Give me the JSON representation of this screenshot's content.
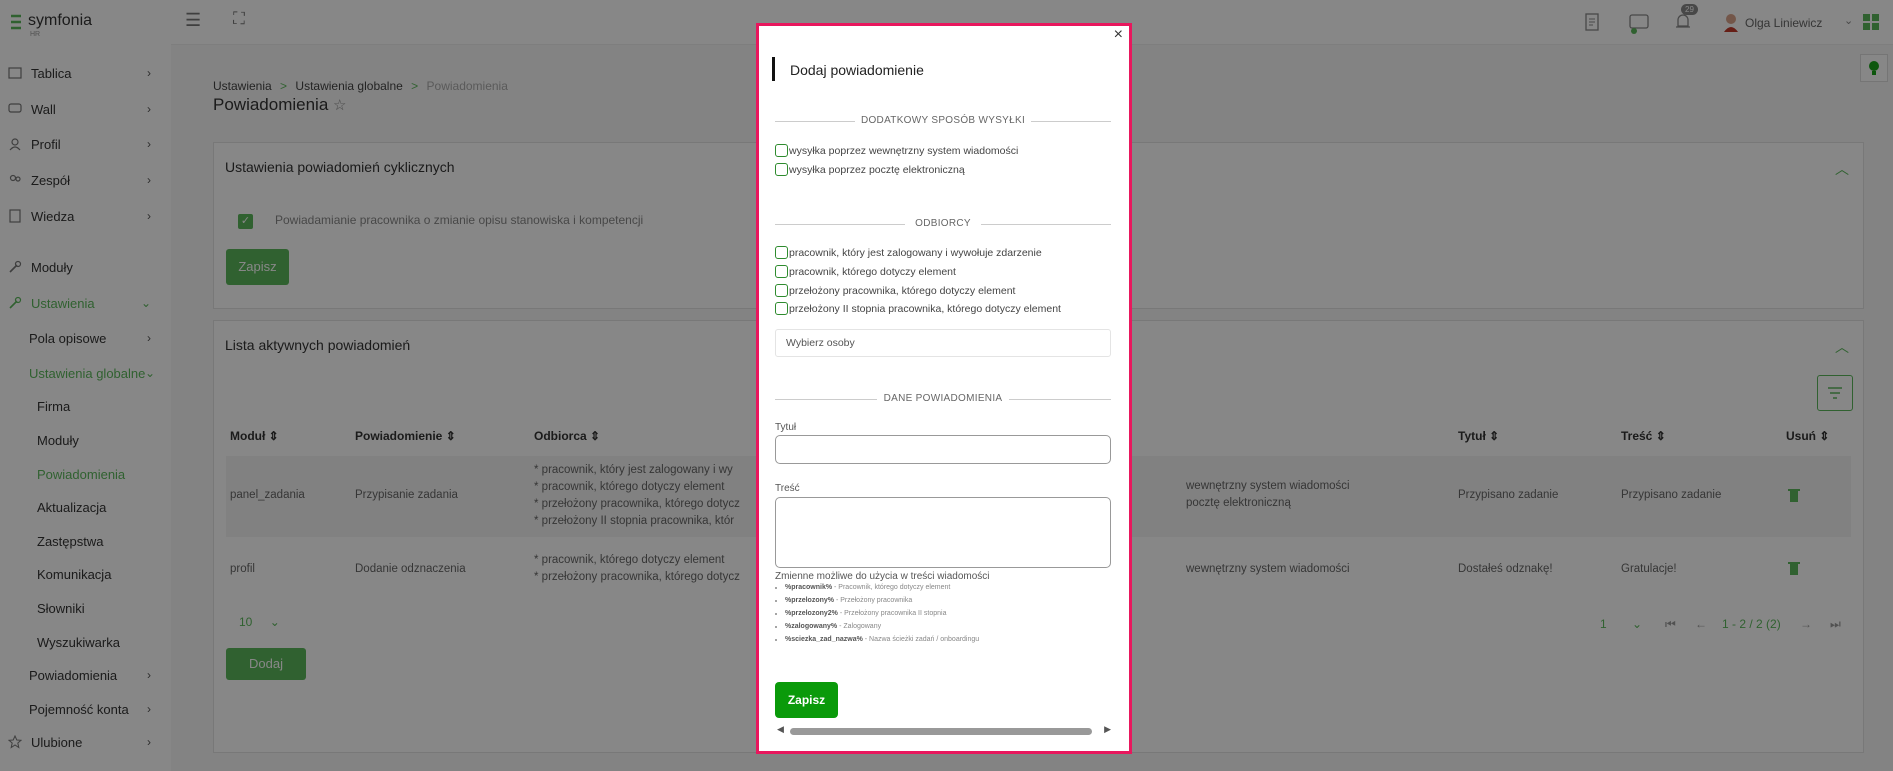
{
  "app": {
    "logo_name": "symfonia",
    "logo_sub": "HR"
  },
  "sidebar": {
    "items": [
      {
        "label": "Tablica",
        "icon": "dashboard-icon"
      },
      {
        "label": "Wall",
        "icon": "chat-icon"
      },
      {
        "label": "Profil",
        "icon": "user-icon"
      },
      {
        "label": "Zespół",
        "icon": "team-icon"
      },
      {
        "label": "Wiedza",
        "icon": "book-icon"
      },
      {
        "label": "Moduły",
        "icon": "wrench-icon"
      },
      {
        "label": "Ustawienia",
        "icon": "settings-icon"
      },
      {
        "label": "Pola opisowe"
      },
      {
        "label": "Ustawienia globalne"
      },
      {
        "label": "Firma"
      },
      {
        "label": "Moduły"
      },
      {
        "label": "Powiadomienia"
      },
      {
        "label": "Aktualizacja"
      },
      {
        "label": "Zastępstwa"
      },
      {
        "label": "Komunikacja"
      },
      {
        "label": "Słowniki"
      },
      {
        "label": "Wyszukiwarka"
      },
      {
        "label": "Powiadomienia"
      },
      {
        "label": "Pojemność konta"
      },
      {
        "label": "Ulubione",
        "icon": "star-icon"
      }
    ]
  },
  "header": {
    "notifications_count": "29",
    "user_name": "Olga Liniewicz"
  },
  "breadcrumb": {
    "items": [
      "Ustawienia",
      "Ustawienia globalne",
      "Powiadomienia"
    ],
    "sep": ">"
  },
  "page": {
    "title": "Powiadomienia"
  },
  "cyclic_panel": {
    "title": "Ustawienia powiadomień cyklicznych",
    "checkbox_label": "Powiadamianie pracownika o zmianie opisu stanowiska i kompetencji",
    "save_label": "Zapisz"
  },
  "list_panel": {
    "title": "Lista aktywnych powiadomień",
    "columns": [
      "Moduł",
      "Powiadomienie",
      "Odbiorca",
      "Tytuł",
      "Treść",
      "Usuń"
    ],
    "rows": [
      {
        "module": "panel_zadania",
        "notification": "Przypisanie zadania",
        "recipients": [
          "* pracownik, który jest zalogowany i wy",
          "* pracownik, którego dotyczy element",
          "* przełożony pracownika, którego dotycz",
          "* przełożony II stopnia pracownika, któr"
        ],
        "method": [
          "wewnętrzny system wiadomości",
          "pocztę elektroniczną"
        ],
        "title": "Przypisano zadanie",
        "content": "Przypisano zadanie"
      },
      {
        "module": "profil",
        "notification": "Dodanie odznaczenia",
        "recipients": [
          "* pracownik, którego dotyczy element",
          "* przełożony pracownika, którego dotycz"
        ],
        "method": [
          "wewnętrzny system wiadomości"
        ],
        "title": "Dostałeś odznakę!",
        "content": "Gratulacje!"
      }
    ],
    "page_size": "10",
    "page_number": "1",
    "page_info": "1 - 2 / 2 (2)",
    "add_label": "Dodaj"
  },
  "modal": {
    "title": "Dodaj powiadomienie",
    "close": "×",
    "section_extra": "DODATKOWY SPOSÓB WYSYŁKI",
    "extra_options": [
      "wysyłka poprzez wewnętrzny system wiadomości",
      "wysyłka poprzez pocztę elektroniczną"
    ],
    "section_recipients": "ODBIORCY",
    "recipient_options": [
      "pracownik, który jest zalogowany i wywołuje zdarzenie",
      "pracownik, którego dotyczy element",
      "przełożony pracownika, którego dotyczy element",
      "przełożony II stopnia pracownika, którego dotyczy element"
    ],
    "select_people_placeholder": "Wybierz osoby",
    "section_data": "DANE POWIADOMIENIA",
    "title_label": "Tytuł",
    "title_value": "",
    "content_label": "Treść",
    "content_value": "",
    "vars_heading": "Zmienne możliwe do użycia w treści wiadomości",
    "vars": [
      {
        "name": "%pracownik%",
        "desc": " - Pracownik, którego dotyczy element"
      },
      {
        "name": "%przelozony%",
        "desc": " - Przełożony pracownika"
      },
      {
        "name": "%przelozony2%",
        "desc": " - Przełożony pracownika II stopnia"
      },
      {
        "name": "%zalogowany%",
        "desc": " - Zalogowany"
      },
      {
        "name": "%sciezka_zad_nazwa%",
        "desc": " - Nazwa ścieżki zadań / onboardingu"
      }
    ],
    "save_label": "Zapisz"
  },
  "colors": {
    "accent_green": "#5cb85c",
    "save_green": "#0a9a0a",
    "modal_border": "#e8175d"
  }
}
